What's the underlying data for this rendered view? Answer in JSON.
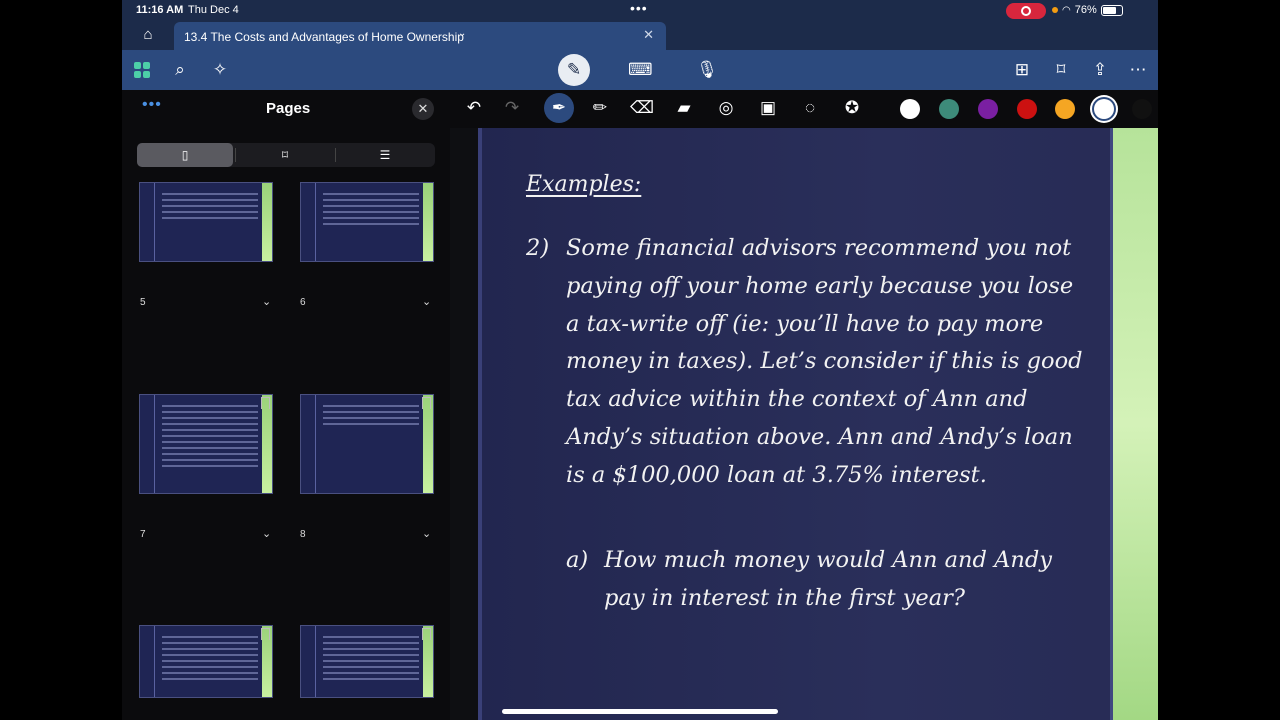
{
  "status": {
    "time": "11:16 AM",
    "date": "Thu Dec 4",
    "battery": "76%"
  },
  "tab": {
    "title": "13.4 The Costs and Advantages of Home Ownership"
  },
  "sidebar": {
    "title": "Pages",
    "pages": [
      {
        "label": "5"
      },
      {
        "label": "6"
      },
      {
        "label": "7"
      },
      {
        "label": "8"
      }
    ]
  },
  "slide": {
    "heading": "Examples:",
    "q_num": "2)",
    "q_text": "Some financial advisors recommend you not paying off your home early because you lose a tax-write off (ie: you’ll have to pay more money in taxes). Let’s consider if this is good tax advice within the context of Ann and Andy’s situation above. Ann and Andy’s loan is a $100,000 loan at 3.75% interest.",
    "sub_num": "a)",
    "sub_text": "How much money would Ann and Andy pay in interest in the first year?"
  },
  "palette": [
    "#ffffff",
    "#3d8b7a",
    "#7a1fa2",
    "#cc1111",
    "#f5a623",
    "#ffffff",
    "#111111"
  ],
  "icons": [
    "home-icon",
    "grid-icon",
    "search-icon",
    "sparkle-icon",
    "pen-icon",
    "keyboard-icon",
    "mic-icon",
    "add-page-icon",
    "bookmark-icon",
    "share-icon",
    "more-icon",
    "undo-icon",
    "redo-icon",
    "pencil-icon",
    "eraser-icon",
    "highlighter-icon",
    "shapes-icon",
    "lasso-icon",
    "star-icon",
    "page-icon",
    "outline-icon"
  ]
}
